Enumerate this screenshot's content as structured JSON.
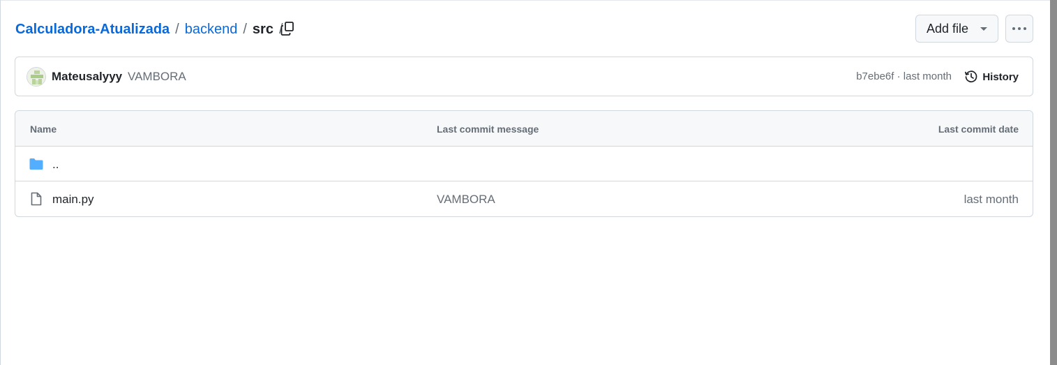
{
  "breadcrumb": {
    "repo": "Calculadora-Atualizada",
    "separator": "/",
    "folder": "backend",
    "current": "src"
  },
  "header": {
    "add_file_label": "Add file",
    "copy_icon": "copy-icon",
    "more_icon": "kebab-horizontal-icon"
  },
  "latest_commit": {
    "author": "Mateusalyyy",
    "message": "VAMBORA",
    "sha": "b7ebe6f",
    "separator": "·",
    "time": "last month",
    "history_label": "History"
  },
  "file_table": {
    "columns": [
      "Name",
      "Last commit message",
      "Last commit date"
    ],
    "rows": [
      {
        "name": "..",
        "icon": "folder-icon",
        "message": "",
        "date": ""
      },
      {
        "name": "main.py",
        "icon": "file-icon",
        "message": "VAMBORA",
        "date": "last month"
      }
    ]
  },
  "colors": {
    "link": "#0969da",
    "muted": "#656d76",
    "border": "#d0d7de",
    "folder": "#54aeff"
  }
}
